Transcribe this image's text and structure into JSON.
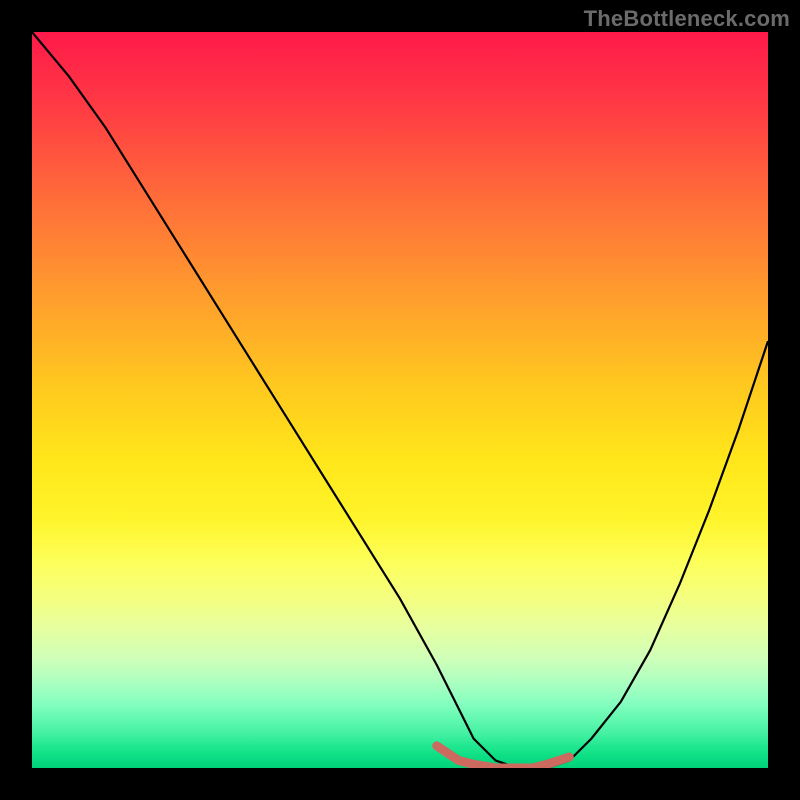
{
  "watermark": "TheBottleneck.com",
  "chart_data": {
    "type": "line",
    "title": "",
    "xlabel": "",
    "ylabel": "",
    "xlim": [
      0,
      100
    ],
    "ylim": [
      0,
      100
    ],
    "grid": false,
    "legend": false,
    "series": [
      {
        "name": "curve",
        "color": "#000000",
        "x": [
          0,
          5,
          10,
          15,
          20,
          25,
          30,
          35,
          40,
          45,
          50,
          55,
          58,
          60,
          63,
          66,
          68,
          70,
          73,
          76,
          80,
          84,
          88,
          92,
          96,
          100
        ],
        "y": [
          100,
          94,
          87,
          79,
          71,
          63,
          55,
          47,
          39,
          31,
          23,
          14,
          8,
          4,
          1,
          0,
          0,
          0,
          1,
          4,
          9,
          16,
          25,
          35,
          46,
          58
        ]
      },
      {
        "name": "highlight",
        "color": "#cc6a5f",
        "x": [
          55,
          58,
          60,
          63,
          66,
          68,
          70,
          73
        ],
        "y": [
          3,
          1,
          0.5,
          0,
          0,
          0,
          0.5,
          1.5
        ]
      }
    ]
  }
}
